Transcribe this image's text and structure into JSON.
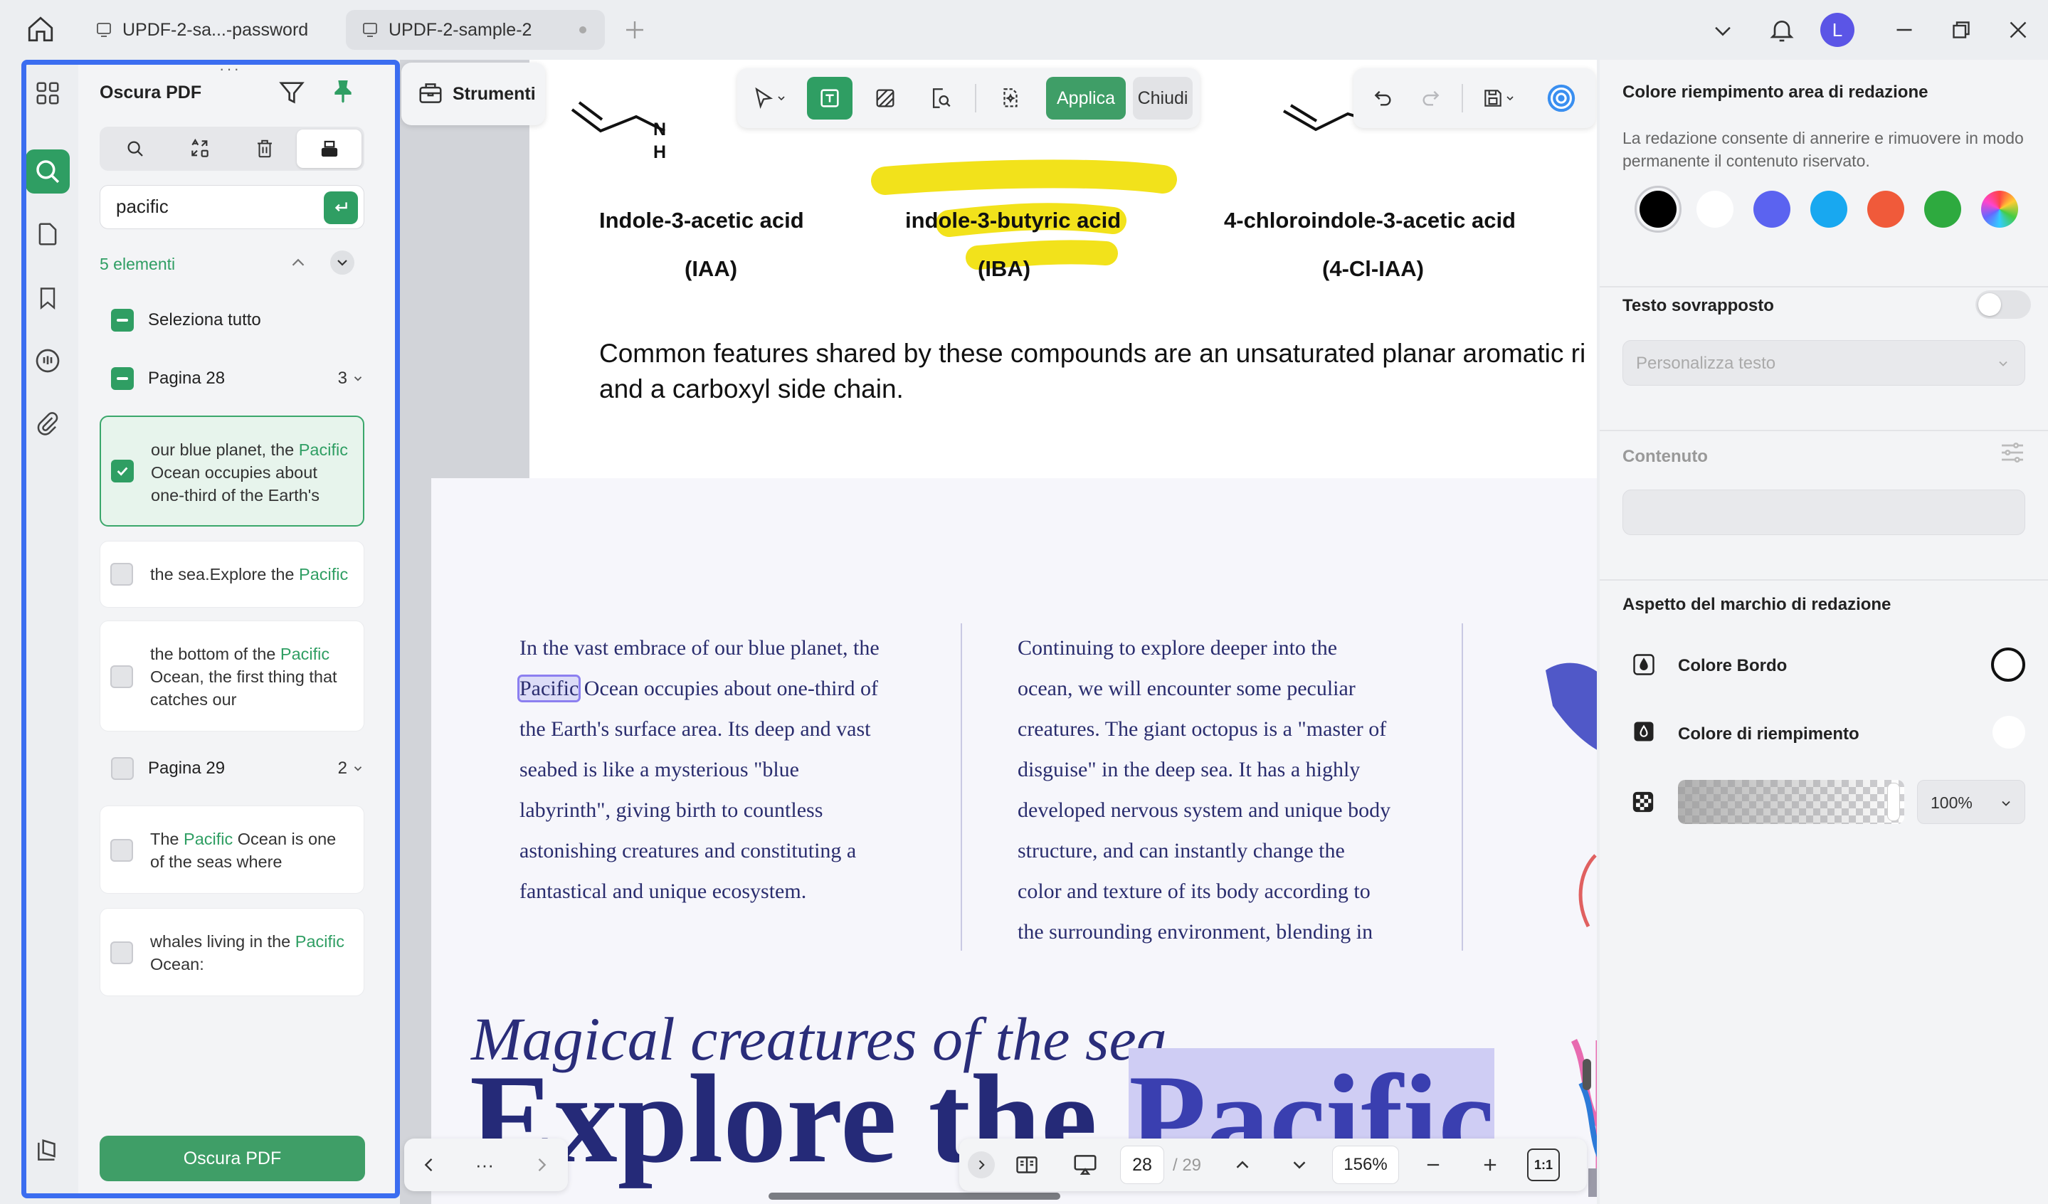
{
  "tabs": [
    {
      "label": "UPDF-2-sa...-password"
    },
    {
      "label": "UPDF-2-sample-2"
    }
  ],
  "user": {
    "initial": "L"
  },
  "left_panel": {
    "title": "Oscura PDF",
    "search_value": "pacific",
    "result_count": "5 elementi",
    "select_all": "Seleziona tutto",
    "pages": [
      {
        "label": "Pagina 28",
        "count": "3"
      },
      {
        "label": "Pagina 29",
        "count": "2"
      }
    ],
    "results": [
      {
        "pre": "our blue planet, the ",
        "hit": "Pacific",
        "post": " Ocean occupies about one-third of the Earth's"
      },
      {
        "pre": "the sea.Explore the ",
        "hit": "Pacific",
        "post": ""
      },
      {
        "pre": "the bottom of the ",
        "hit": "Pacific",
        "post": " Ocean, the first thing that catches our"
      },
      {
        "pre": "The ",
        "hit": "Pacific",
        "post": " Ocean is one of the seas where"
      },
      {
        "pre": "whales living in the ",
        "hit": "Pacific",
        "post": " Ocean:"
      }
    ],
    "apply_button": "Oscura PDF"
  },
  "toolbar": {
    "strumenti": "Strumenti",
    "applica": "Applica",
    "chiudi": "Chiudi"
  },
  "document": {
    "chem_atoms": {
      "n": "N",
      "h": "H"
    },
    "chem": [
      {
        "name": "Indole-3-acetic acid",
        "abbr": "(IAA)"
      },
      {
        "name": "indole-3-butyric acid",
        "abbr": "(IBA)"
      },
      {
        "name": "4-chloroindole-3-acetic acid",
        "abbr": "(4-Cl-IAA)"
      }
    ],
    "common_line1": "Common features shared by these compounds are an unsaturated planar aromatic ri",
    "common_line2": "and a carboxyl side chain.",
    "col1": {
      "l1": "In the vast embrace of our blue planet, the",
      "l2_hit": "Pacific",
      "l2_rest": " Ocean occupies about one-third of",
      "l3": "the Earth's surface area. Its deep and vast",
      "l4": "seabed is like a mysterious \"blue",
      "l5": "labyrinth\", giving birth to countless",
      "l6": "astonishing creatures and constituting a",
      "l7": "fantastical and unique ecosystem."
    },
    "col2": {
      "l1": "Continuing to explore deeper into the",
      "l2": "ocean, we will encounter some peculiar",
      "l3": "creatures. The giant octopus is a \"master of",
      "l4": "disguise\" in the deep sea. It has a highly",
      "l5": "developed nervous system and unique body",
      "l6": "structure, and can instantly change the",
      "l7": "color and texture of its body according to",
      "l8": "the surrounding environment, blending in"
    },
    "heading_italic": "Magical creatures of the sea.",
    "heading_big_1": "Explore the ",
    "heading_big_hit": "Pacific",
    "edge_text": "a"
  },
  "bottom_bar": {
    "more": "···",
    "page_current": "28",
    "page_total": "/ 29",
    "zoom": "156%",
    "fit": "1:1"
  },
  "right_panel": {
    "fill_title": "Colore riempimento area di redazione",
    "fill_desc": "La redazione consente di annerire e rimuovere in modo permanente il contenuto riservato.",
    "swatches": [
      "#000000",
      "#ffffff",
      "#5b63f0",
      "#18a8f0",
      "#f05a3a",
      "#2eaa3f",
      "rainbow"
    ],
    "overlay_title": "Testo sovrapposto",
    "overlay_placeholder": "Personalizza testo",
    "content_title": "Contenuto",
    "mark_title": "Aspetto del marchio di redazione",
    "border_color": "Colore Bordo",
    "fill_color": "Colore di riempimento",
    "opacity": "100%"
  },
  "colors": {
    "accent": "#2f9e63",
    "frame": "#3b6df0",
    "doc_text": "#2a2d6e"
  }
}
